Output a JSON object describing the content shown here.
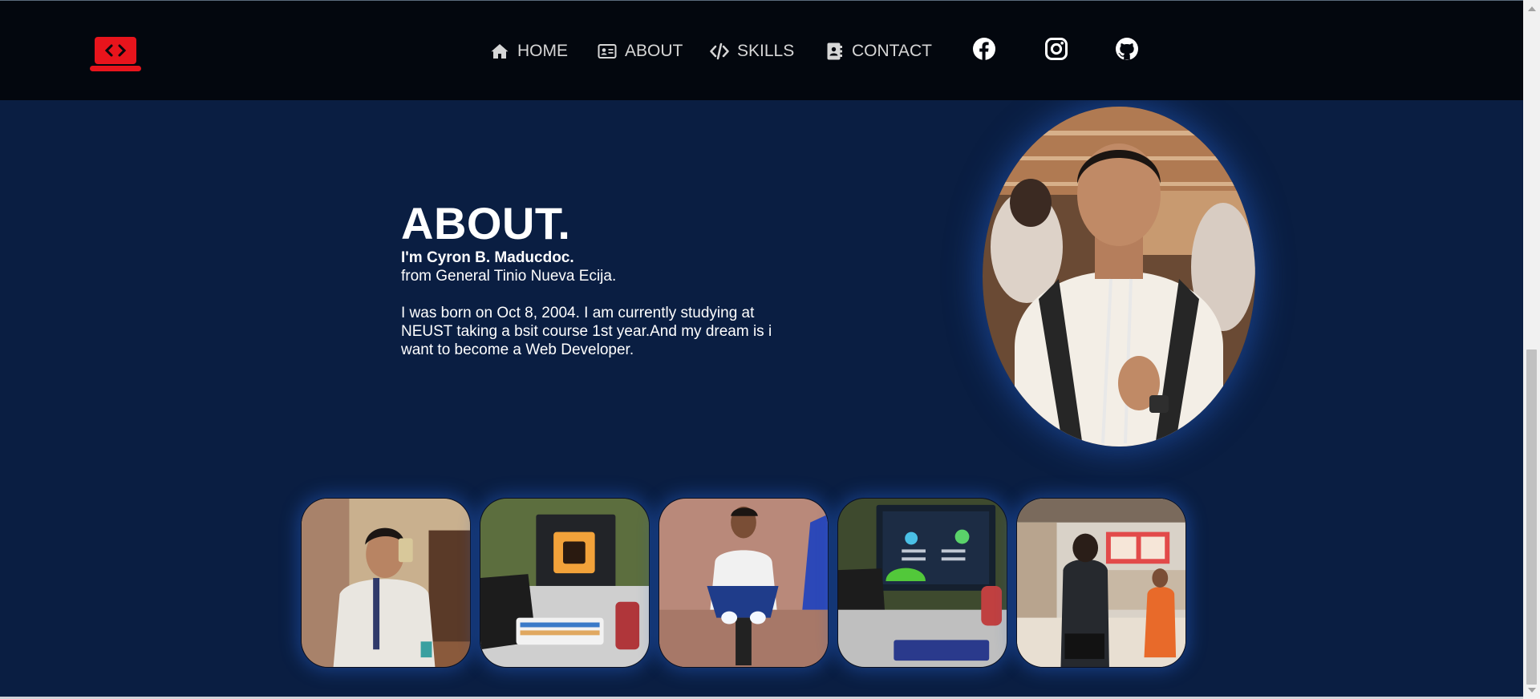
{
  "nav": {
    "logo_icon": "laptop-code-icon",
    "links": [
      {
        "label": "HOME",
        "icon": "home-icon"
      },
      {
        "label": "ABOUT",
        "icon": "id-card-icon"
      },
      {
        "label": "SKILLS",
        "icon": "code-icon"
      },
      {
        "label": "CONTACT",
        "icon": "address-book-icon"
      }
    ],
    "social": [
      "facebook-icon",
      "instagram-icon",
      "github-icon"
    ]
  },
  "about": {
    "title": "ABOUT.",
    "name": "I'm Cyron B. Maducdoc.",
    "from": "from General Tinio Nueva Ecija.",
    "bio": "I was born on Oct 8, 2004. I am currently studying at NEUST taking a bsit course 1st year.And my dream is i want to become a Web Developer."
  },
  "gallery": [
    "photo-selfie",
    "photo-desk-setup",
    "photo-motorcycle",
    "photo-computer-monitor",
    "photo-restaurant"
  ],
  "colors": {
    "background": "#0a1e42",
    "navbar": "#03070e",
    "accent": "#e8141c",
    "nav_text": "#d6d6d6",
    "glow": "#2864d2"
  }
}
